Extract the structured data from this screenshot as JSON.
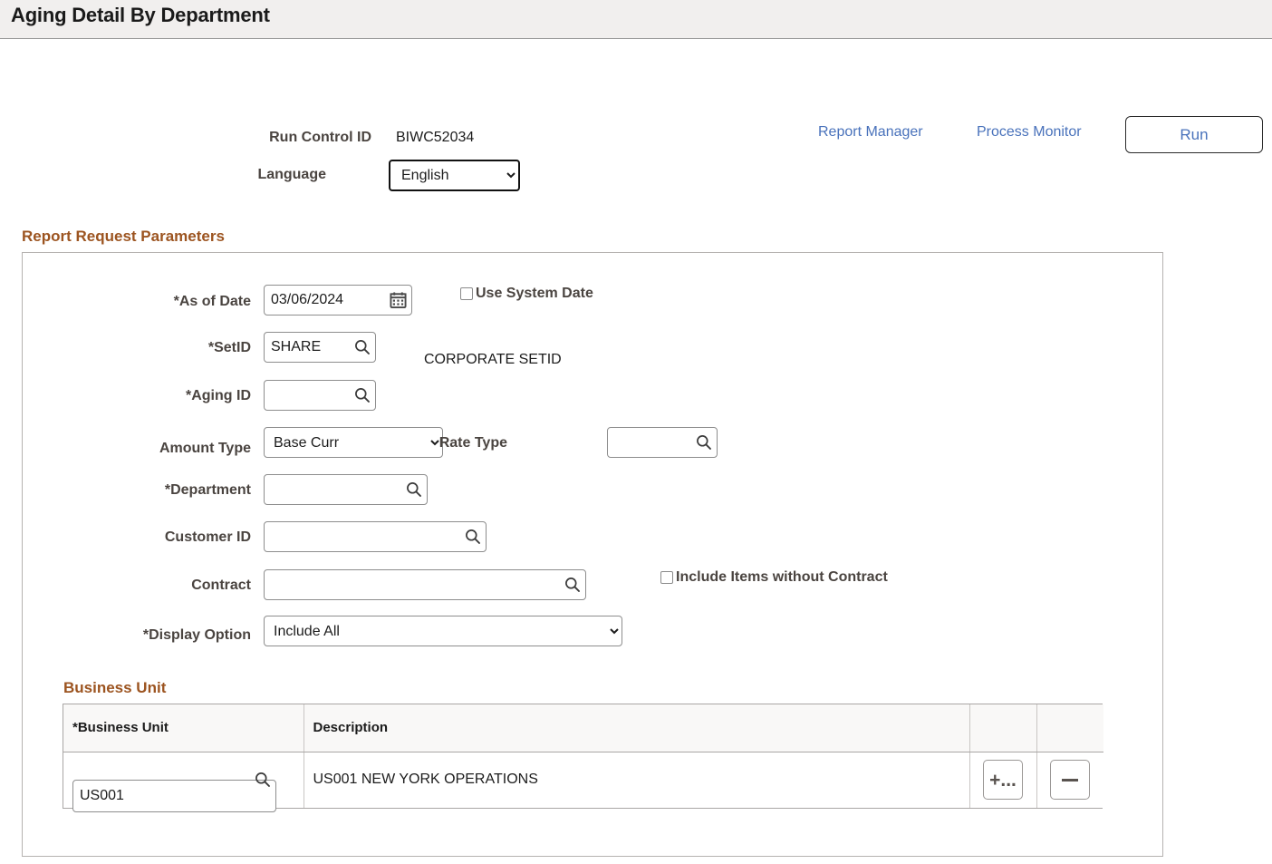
{
  "header": {
    "title": "Aging Detail By Department"
  },
  "runcontrol": {
    "run_control_id_label": "Run Control ID",
    "run_control_id_value": "BIWC52034",
    "language_label": "Language",
    "language_value": "English",
    "language_options": [
      "English"
    ],
    "report_manager_link": "Report Manager",
    "process_monitor_link": "Process Monitor",
    "run_button": "Run"
  },
  "report_request_parameters": {
    "caption": "Report Request Parameters",
    "as_of_date": {
      "label": "*As of Date",
      "value": "03/06/2024",
      "icon": "calendar-icon"
    },
    "use_system_date": {
      "label": "Use System Date",
      "checked": false
    },
    "setid": {
      "label": "*SetID",
      "value": "SHARE",
      "icon": "search-icon",
      "description": "CORPORATE SETID"
    },
    "aging_id": {
      "label": "*Aging ID",
      "value": "",
      "icon": "search-icon"
    },
    "amount_type": {
      "label": "Amount Type",
      "value": "Base Curr",
      "options": [
        "Base Curr"
      ]
    },
    "rate_type": {
      "label": "Rate Type",
      "value": "",
      "icon": "search-icon"
    },
    "department": {
      "label": "*Department",
      "value": "",
      "icon": "search-icon"
    },
    "customer_id": {
      "label": "Customer ID",
      "value": "",
      "icon": "search-icon"
    },
    "contract": {
      "label": "Contract",
      "value": "",
      "icon": "search-icon"
    },
    "include_items_without_contract": {
      "label": "Include Items without Contract",
      "checked": false
    },
    "display_option": {
      "label": "*Display Option",
      "value": "Include All",
      "options": [
        "Include All"
      ]
    }
  },
  "business_unit": {
    "caption": "Business Unit",
    "columns": [
      "*Business Unit",
      "Description",
      "",
      ""
    ],
    "rows": [
      {
        "business_unit": "US001",
        "description": "US001 NEW YORK OPERATIONS",
        "add_button": "+...",
        "delete_button": "—"
      }
    ]
  },
  "colors": {
    "accent_caption": "#9c5420",
    "link": "#4972bb",
    "label": "#4a4440",
    "header_bg": "#f1efee"
  }
}
